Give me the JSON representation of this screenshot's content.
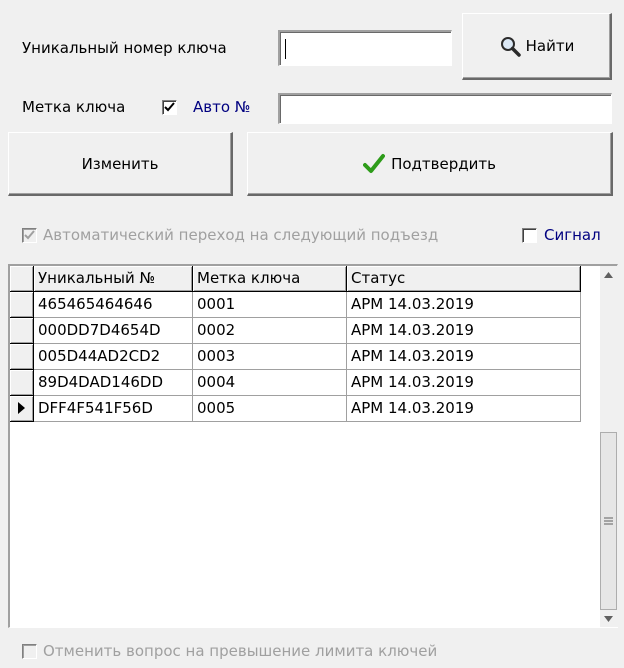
{
  "search": {
    "unique_label": "Уникальный номер ключа",
    "unique_value": "",
    "find_label": "Найти"
  },
  "tag": {
    "label": "Метка ключа",
    "auto_label": "Авто №",
    "auto_checked": true,
    "value": ""
  },
  "actions": {
    "change_label": "Изменить",
    "confirm_label": "Подтвердить"
  },
  "options": {
    "auto_next_label": "Автоматический переход на следующий подъезд",
    "auto_next_checked": true,
    "signal_label": "Сигнал",
    "signal_checked": false,
    "cancel_limit_label": "Отменить вопрос на превышение лимита ключей",
    "cancel_limit_checked": false
  },
  "table": {
    "columns": [
      "Уникальный №",
      "Метка ключа",
      "Статус"
    ],
    "rows": [
      [
        "465465464646",
        "0001",
        "АРМ 14.03.2019"
      ],
      [
        "000DD7D4654D",
        "0002",
        "АРМ 14.03.2019"
      ],
      [
        "005D44AD2CD2",
        "0003",
        "АРМ 14.03.2019"
      ],
      [
        "89D4DAD146DD",
        "0004",
        "АРМ 14.03.2019"
      ],
      [
        "DFF4F541F56D",
        "0005",
        "АРМ 14.03.2019"
      ]
    ],
    "current_row": 4
  },
  "colors": {
    "accent_blue": "#000080",
    "check_green": "#2e9c1a"
  },
  "icons": {
    "find": "magnifier-icon",
    "confirm": "checkmark-icon",
    "current_row": "row-pointer-icon"
  }
}
